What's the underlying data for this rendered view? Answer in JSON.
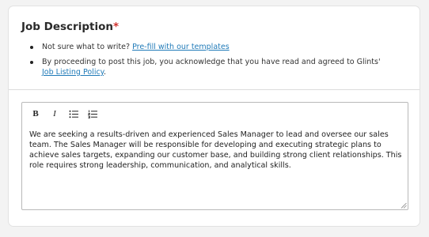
{
  "section": {
    "title": "Job Description",
    "required_marker": "*"
  },
  "notes": {
    "prefill_prefix": "Not sure what to write?",
    "prefill_link": "Pre-fill with our templates",
    "policy_text": "By proceeding to post this job, you acknowledge that you have read and agreed to Glints'",
    "policy_link": "Job Listing Policy",
    "policy_suffix": "."
  },
  "editor": {
    "toolbar": {
      "bold_label": "B",
      "italic_label": "I",
      "bulleted_list_icon": "bulleted-list-icon",
      "numbered_list_icon": "numbered-list-icon"
    },
    "content": "We are seeking a results-driven and experienced Sales Manager to lead and oversee our sales team. The Sales Manager will be responsible for developing and executing strategic plans to achieve sales targets, expanding our customer base, and building strong client relationships. This role requires strong leadership, communication, and analytical skills."
  },
  "colors": {
    "required": "#d0312d",
    "link": "#1f7ab8"
  }
}
